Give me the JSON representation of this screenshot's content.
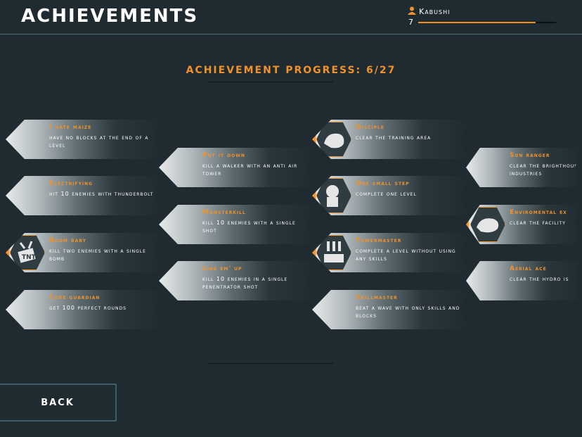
{
  "header": {
    "title": "ACHIEVEMENTS",
    "username": "Kabushi",
    "level": "7",
    "xp_fraction": 0.85
  },
  "progress": {
    "label": "ACHIEVEMENT PROGRESS: 6/27"
  },
  "achievements": [
    {
      "name": "I hate maize",
      "desc": "have no blocks at the end of a level",
      "unlocked": false
    },
    {
      "name": "Electrifying",
      "desc": "hit 10 enemies with thunderbolt",
      "unlocked": false
    },
    {
      "name": "Boom baby",
      "desc": "kill two enemies with a single bomb",
      "unlocked": true,
      "icon": "tnt-icon"
    },
    {
      "name": "Core guardian",
      "desc": "get 100 perfect rounds",
      "unlocked": false
    },
    {
      "name": "Put it down",
      "desc": "kill a walker with an anti air tower",
      "unlocked": false
    },
    {
      "name": "Monsterkill",
      "desc": "kill 10 enemies with a single shot",
      "unlocked": false
    },
    {
      "name": "Line em' up",
      "desc": "kill 10 enemies in a single penentrator shot",
      "unlocked": false
    },
    {
      "name": "Disciple",
      "desc": "clear the training area",
      "unlocked": true,
      "icon": "fist-icon"
    },
    {
      "name": "One small step",
      "desc": "complete one level",
      "unlocked": true,
      "icon": "astronaut-icon"
    },
    {
      "name": "Towermaster",
      "desc": "complete a level without using any skills",
      "unlocked": true,
      "icon": "tower-icon"
    },
    {
      "name": "Skillmaster",
      "desc": "beat a wave with only skills and blocks",
      "unlocked": false
    },
    {
      "name": "Sun ranger",
      "desc": "clear the brighthouse industries",
      "unlocked": false
    },
    {
      "name": "Enviromental ex",
      "desc": "clear the facility",
      "unlocked": true,
      "icon": "beast-icon"
    },
    {
      "name": "Aerial ace",
      "desc": "clear the hydro is",
      "unlocked": false
    }
  ],
  "back": {
    "label": "BACK"
  },
  "colors": {
    "accent": "#f0922a",
    "background": "#1f2b30"
  }
}
